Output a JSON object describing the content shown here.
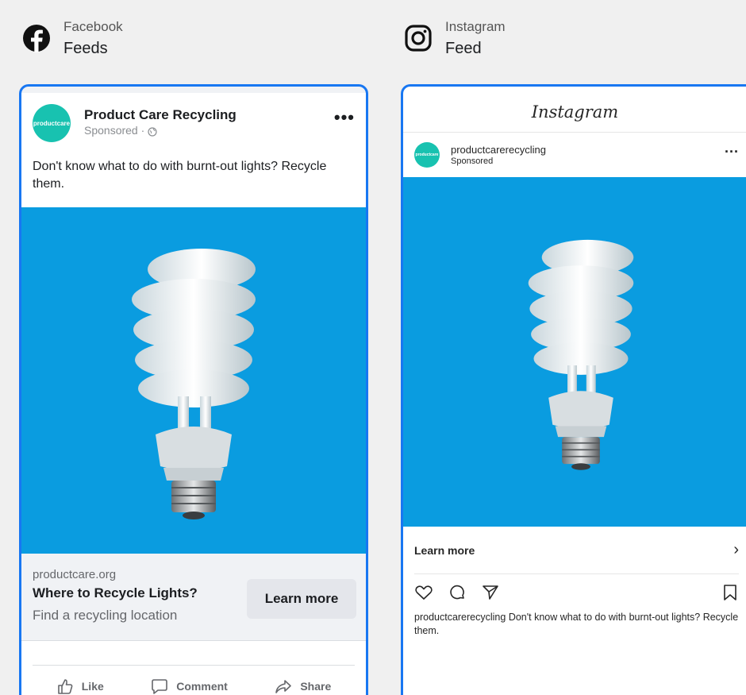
{
  "facebook": {
    "platform": "Facebook",
    "placement": "Feeds",
    "post": {
      "avatar_text": "productcare",
      "page_name": "Product Care Recycling",
      "sponsored": "Sponsored ·",
      "text": "Don't know what to do with burnt-out lights? Recycle them.",
      "link": {
        "domain": "productcare.org",
        "headline": "Where to Recycle Lights?",
        "description": "Find a recycling location",
        "cta": "Learn more"
      },
      "actions": {
        "like": "Like",
        "comment": "Comment",
        "share": "Share"
      }
    }
  },
  "instagram": {
    "platform": "Instagram",
    "placement": "Feed",
    "wordmark": "Instagram",
    "post": {
      "avatar_text": "productcare",
      "username": "productcarerecycling",
      "sponsored": "Sponsored",
      "cta": "Learn more",
      "caption_user": "productcarerecycling",
      "caption_text": "Don't know what to do with burnt-out lights? Recycle them."
    }
  },
  "colors": {
    "accent_border": "#1877f2",
    "ad_background": "#0a9ce0",
    "avatar": "#18c2b0"
  },
  "icons": [
    "facebook-logo-icon",
    "instagram-logo-icon",
    "globe-icon",
    "more-icon",
    "like-icon",
    "comment-icon",
    "share-icon",
    "heart-icon",
    "ig-comment-icon",
    "send-icon",
    "bookmark-icon",
    "chevron-right-icon"
  ]
}
